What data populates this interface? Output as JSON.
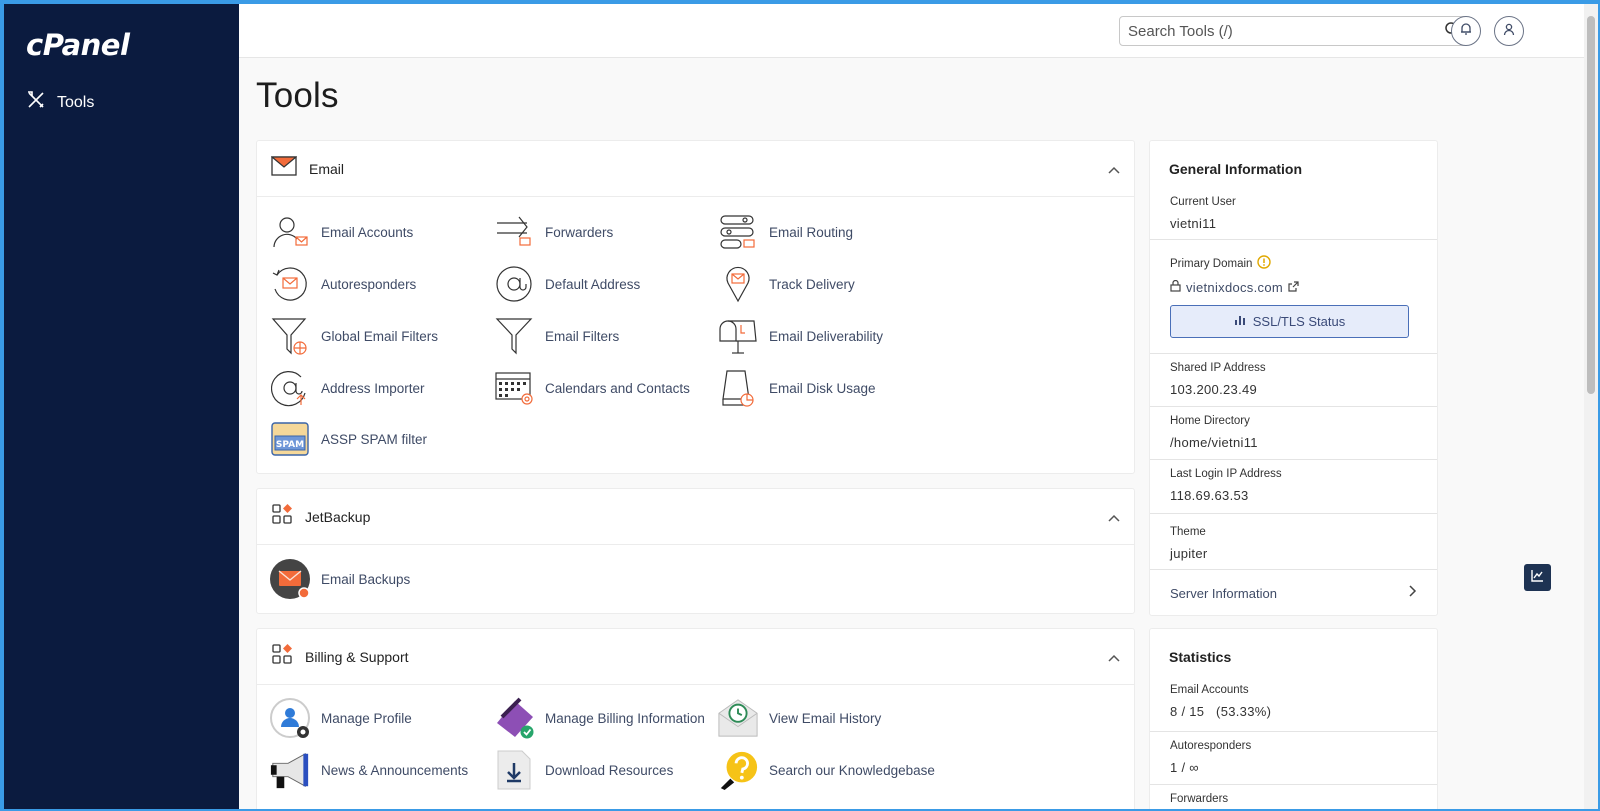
{
  "sidebar": {
    "logo": "cPanel",
    "nav_tools_label": "Tools"
  },
  "header": {
    "search_placeholder": "Search Tools (/)"
  },
  "page": {
    "title": "Tools"
  },
  "email_section": {
    "title": "Email",
    "items": [
      "Email Accounts",
      "Forwarders",
      "Email Routing",
      "Autoresponders",
      "Default Address",
      "Track Delivery",
      "Global Email Filters",
      "Email Filters",
      "Email Deliverability",
      "Address Importer",
      "Calendars and Contacts",
      "Email Disk Usage",
      "ASSP SPAM filter"
    ],
    "spam_icon_text": "SPAM"
  },
  "jetbackup_section": {
    "title": "JetBackup",
    "items": [
      "Email Backups"
    ]
  },
  "billing_section": {
    "title": "Billing & Support",
    "items": [
      "Manage Profile",
      "Manage Billing Information",
      "View Email History",
      "News & Announcements",
      "Download Resources",
      "Search our Knowledgebase"
    ]
  },
  "general_info": {
    "title": "General Information",
    "current_user_label": "Current User",
    "current_user": "vietni11",
    "primary_domain_label": "Primary Domain",
    "primary_domain": "vietnixdocs.com",
    "ssl_button": "SSL/TLS Status",
    "shared_ip_label": "Shared IP Address",
    "shared_ip": "103.200.23.49",
    "home_dir_label": "Home Directory",
    "home_dir": "/home/vietni11",
    "last_login_label": "Last Login IP Address",
    "last_login": "118.69.63.53",
    "theme_label": "Theme",
    "theme": "jupiter",
    "server_info": "Server Information"
  },
  "statistics": {
    "title": "Statistics",
    "email_accounts_label": "Email Accounts",
    "email_accounts_value": "8 / 15   (53.33%)",
    "autoresponders_label": "Autoresponders",
    "autoresponders_value": "1 / ∞",
    "forwarders_label": "Forwarders"
  },
  "colors": {
    "sidebar_bg": "#0b1b3f",
    "accent_orange": "#f26b3a",
    "link_text": "#3f4b66"
  }
}
